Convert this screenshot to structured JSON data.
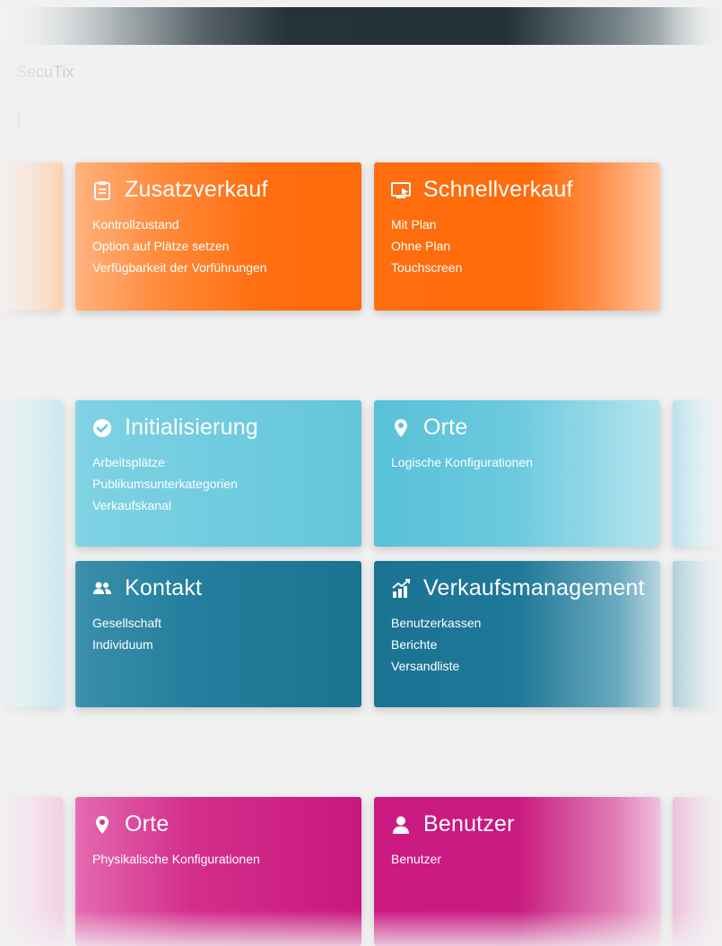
{
  "app": {
    "brand": "SecuTix",
    "subtitle": "|"
  },
  "tiles": {
    "zusatz": {
      "title": "Zusatzverkauf",
      "icon": "clipboard-icon",
      "items": [
        "Kontrollzustand",
        "Option auf Plätze setzen",
        "Verfügbarkeit der Vorführungen"
      ]
    },
    "schnell": {
      "title": "Schnellverkauf",
      "icon": "screen-cursor-icon",
      "items": [
        "Mit Plan",
        "Ohne Plan",
        "Touchscreen"
      ]
    },
    "init": {
      "title": "Initialisierung",
      "icon": "check-circle-icon",
      "items": [
        "Arbeitsplätze",
        "Publikumsunterkategorien",
        "Verkaufskanal"
      ]
    },
    "orte1": {
      "title": "Orte",
      "icon": "map-marker-icon",
      "items": [
        "Logische Konfigurationen"
      ]
    },
    "kontakt": {
      "title": "Kontakt",
      "icon": "users-icon",
      "items": [
        "Gesellschaft",
        "Individuum"
      ]
    },
    "verkaufsmgmt": {
      "title": "Verkaufsmanagement",
      "icon": "chart-icon",
      "items": [
        "Benutzerkassen",
        "Berichte",
        "Versandliste"
      ]
    },
    "orte2": {
      "title": "Orte",
      "icon": "map-marker-icon",
      "items": [
        "Physikalische Konfigurationen"
      ]
    },
    "benutzer": {
      "title": "Benutzer",
      "icon": "user-icon",
      "items": [
        "Benutzer"
      ]
    }
  },
  "colors": {
    "orange": "#ff6a0a",
    "cyan": "#63c6dc",
    "teal": "#1a7391",
    "magenta": "#c8187e",
    "topbar": "#253238"
  }
}
